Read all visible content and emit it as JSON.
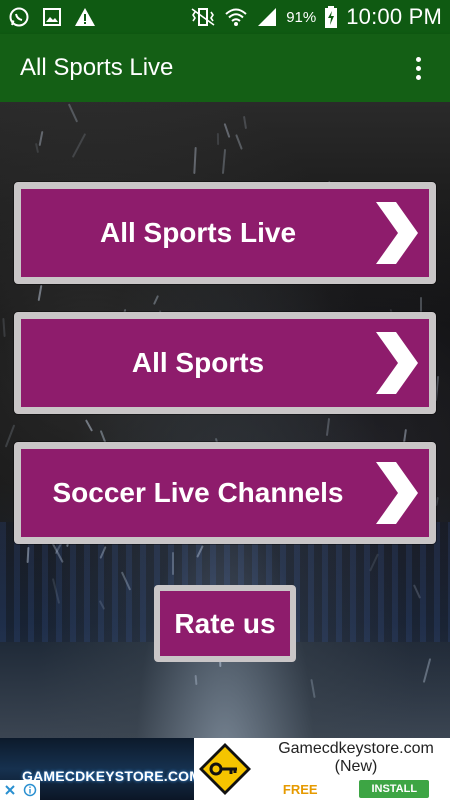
{
  "status_bar": {
    "battery_text": "91%",
    "time": "10:00 PM",
    "icons": [
      "whatsapp-icon",
      "gallery-icon",
      "warning-icon",
      "vibrate-icon",
      "wifi-icon",
      "signal-icon",
      "battery-charging-icon"
    ]
  },
  "app_bar": {
    "title": "All Sports Live",
    "menu_icon": "overflow-menu-icon"
  },
  "menu": {
    "items": [
      {
        "label": "All Sports Live"
      },
      {
        "label": "All Sports"
      },
      {
        "label": "Soccer Live Channels"
      }
    ],
    "rate_label": "Rate us"
  },
  "ad": {
    "banner_text": "GAMECDKEYSTORE.COM",
    "site": "Gamecdkeystore.com",
    "tag": "(New)",
    "price": "FREE",
    "cta": "INSTALL"
  },
  "colors": {
    "status_bar": "#0f5a12",
    "app_bar": "#145f15",
    "button_fill": "#8e1c6c",
    "button_border": "#c9c6c7",
    "install_green": "#3da544",
    "free_orange": "#e69a00"
  }
}
